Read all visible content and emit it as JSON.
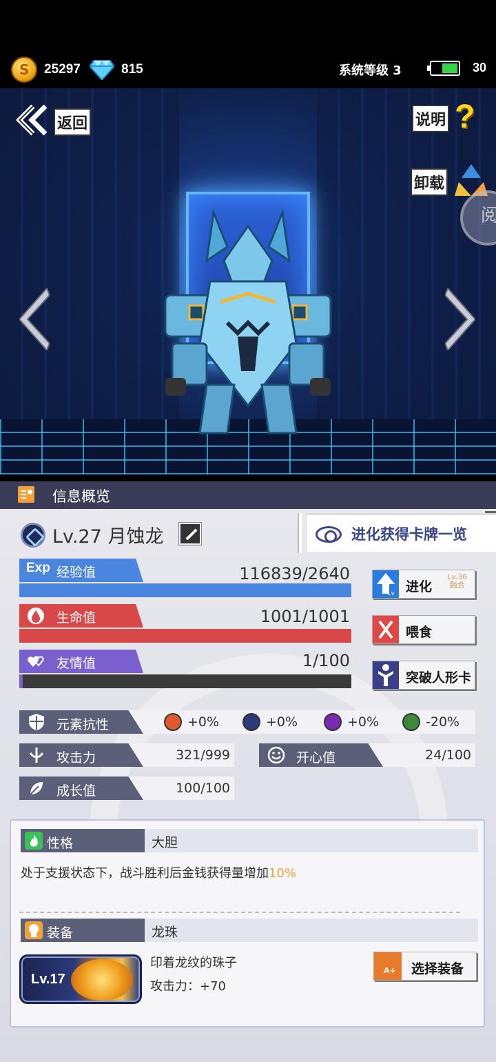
{
  "status": {
    "coins": "25297",
    "gems": "815",
    "system_level": "系统等级 3",
    "battery": "30"
  },
  "scene": {
    "back_label": "返回",
    "help_label": "说明",
    "help_symbol": "?",
    "unload_label": "卸载",
    "read_badge": "阅"
  },
  "info": {
    "title": "信息概览"
  },
  "pet": {
    "level_name": "Lv.27 月蚀龙",
    "evolution_list_label": "进化获得卡牌一览"
  },
  "stats": {
    "exp": {
      "icon_text": "Exp",
      "label": "经验值",
      "value": "116839/2640",
      "fill": 1.0,
      "color": "#4a86e0"
    },
    "hp": {
      "label": "生命值",
      "value": "1001/1001",
      "fill": 1.0,
      "color": "#d84848"
    },
    "friendship": {
      "label": "友情值",
      "value": "1/100",
      "fill": 0.01,
      "color": "#7a5fcf"
    }
  },
  "actions": {
    "evolve": {
      "label": "进化",
      "sub1": "Lv.36",
      "sub2": "融合"
    },
    "feed": {
      "label": "喂食"
    },
    "breakthrough": {
      "label": "突破人形卡"
    }
  },
  "attributes": {
    "resistance": {
      "label": "元素抗性",
      "fire": "+0%",
      "water": "+0%",
      "thunder": "+0%",
      "poison": "-20%"
    },
    "attack": {
      "label": "攻击力",
      "value": "321/999"
    },
    "happiness": {
      "label": "开心值",
      "value": "24/100"
    },
    "growth": {
      "label": "成长值",
      "value": "100/100"
    }
  },
  "trait": {
    "label": "性格",
    "value": "大胆",
    "desc": "处于支援状态下，战斗胜利后金钱获得量增加",
    "desc_pct": "10%"
  },
  "equipment": {
    "label": "装备",
    "value": "龙珠",
    "level": "Lv.17",
    "name": "印着龙纹的珠子",
    "attack": "攻击力：+70",
    "select_label": "选择装备"
  }
}
